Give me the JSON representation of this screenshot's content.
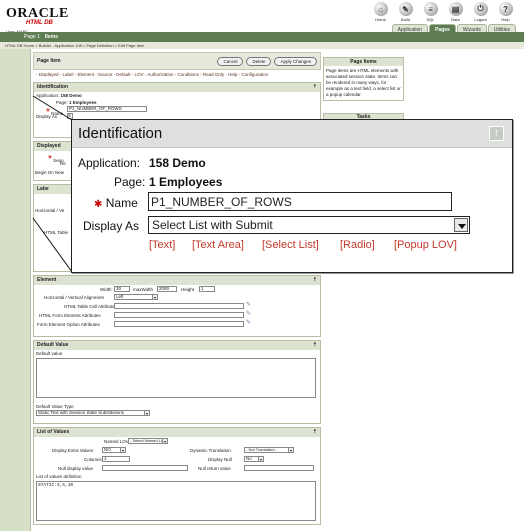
{
  "header": {
    "logo_top": "ORACLE",
    "logo_bottom": "HTML DB",
    "user": "User: MARC",
    "icons": [
      {
        "label": "Home",
        "glyph": "⌂",
        "name": "home-icon"
      },
      {
        "label": "Build",
        "glyph": "✎",
        "name": "build-icon"
      },
      {
        "label": "SQL",
        "glyph": "≡",
        "name": "sql-icon"
      },
      {
        "label": "Data",
        "glyph": "▤",
        "name": "data-icon"
      },
      {
        "label": "Logout",
        "glyph": "⏻",
        "name": "logout-icon"
      },
      {
        "label": "Help",
        "glyph": "?",
        "name": "help-icon"
      }
    ],
    "tabs": [
      {
        "label": "Application",
        "active": false
      },
      {
        "label": "Pages",
        "active": true
      },
      {
        "label": "Wizards",
        "active": false
      },
      {
        "label": "Utilities",
        "active": false
      }
    ]
  },
  "bar": {
    "page": "Page 1",
    "section": "Items"
  },
  "breadcrumb": "HTML DB Home > Builder - Application 108 > Page Definition > Edit Page Item",
  "page_item": {
    "title": "Page Item",
    "cancel": "Cancel",
    "delete": "Delete",
    "apply": "Apply Changes",
    "links": "- Displayed - Label - Element - Source - Default - LOV - Authorization - Conditions - Read Only - Help - Configuration"
  },
  "identification_small": {
    "title": "Identification",
    "application_label": "Application",
    "application_value": "158 Demo",
    "page_label": "Page",
    "page_value": "1 Employees",
    "name_label": "Name",
    "name_value": "P1_NUMBER_OF_ROWS",
    "display_as_label": "Display As",
    "display_as_value": "S"
  },
  "displayed": {
    "title": "Displayed",
    "seq_label": "Sequ",
    "region_label": "Re",
    "begin_label": "Begin On New"
  },
  "label_section": {
    "title": "Labe",
    "align_label": "Horizontal / Ve",
    "html_label": "HTML Table"
  },
  "element": {
    "title": "Element",
    "width_label": "Width",
    "width_value": "30",
    "maxwidth_label": "maxWidth",
    "maxwidth_value": "2000",
    "height_label": "Height",
    "height_value": "1",
    "align_label": "Horizontal / Vertical Alignment",
    "align_value": "Left",
    "cell_attr_label": "HTML Table Cell Attributes",
    "form_attr_label": "HTML Form Element Attributes",
    "option_attr_label": "Form Element Option Attributes"
  },
  "default_value": {
    "title": "Default Value",
    "value_label": "Default value",
    "type_label": "Default Value Type",
    "type_value": "Static Text with Session State Substitutions"
  },
  "lov": {
    "title": "List of Values",
    "named_label": "Named LOV",
    "named_value": "- Select Named LOV -",
    "extra_label": "Display Extra Values",
    "extra_value": "NO",
    "dyn_label": "Dynamic Translation",
    "dyn_value": "- Not Translated -",
    "columns_label": "Columns",
    "columns_value": "1",
    "display_null_label": "Display Null",
    "display_null_value": "No",
    "null_display_label": "Null display value",
    "null_return_label": "Null return value",
    "definition_label": "List of values definition",
    "definition_value": "STATIC:3,5,10"
  },
  "help": {
    "title": "Page Items",
    "text": "Page items are HTML elements with associated session state. Items can be rendered in many ways, for example as a text field, a select list or a popup calendar.",
    "tasks": "Tasks"
  },
  "zoom": {
    "title": "Identification",
    "application_label": "Application:",
    "application_value": "158 Demo",
    "page_label": "Page:",
    "page_value": "1 Employees",
    "name_label": "Name",
    "name_value": "P1_NUMBER_OF_ROWS",
    "display_as_label": "Display As",
    "display_as_value": "Select List with Submit",
    "links": [
      "[Text]",
      "[Text Area]",
      "[Select List]",
      "[Radio]",
      "[Popup LOV]"
    ]
  }
}
